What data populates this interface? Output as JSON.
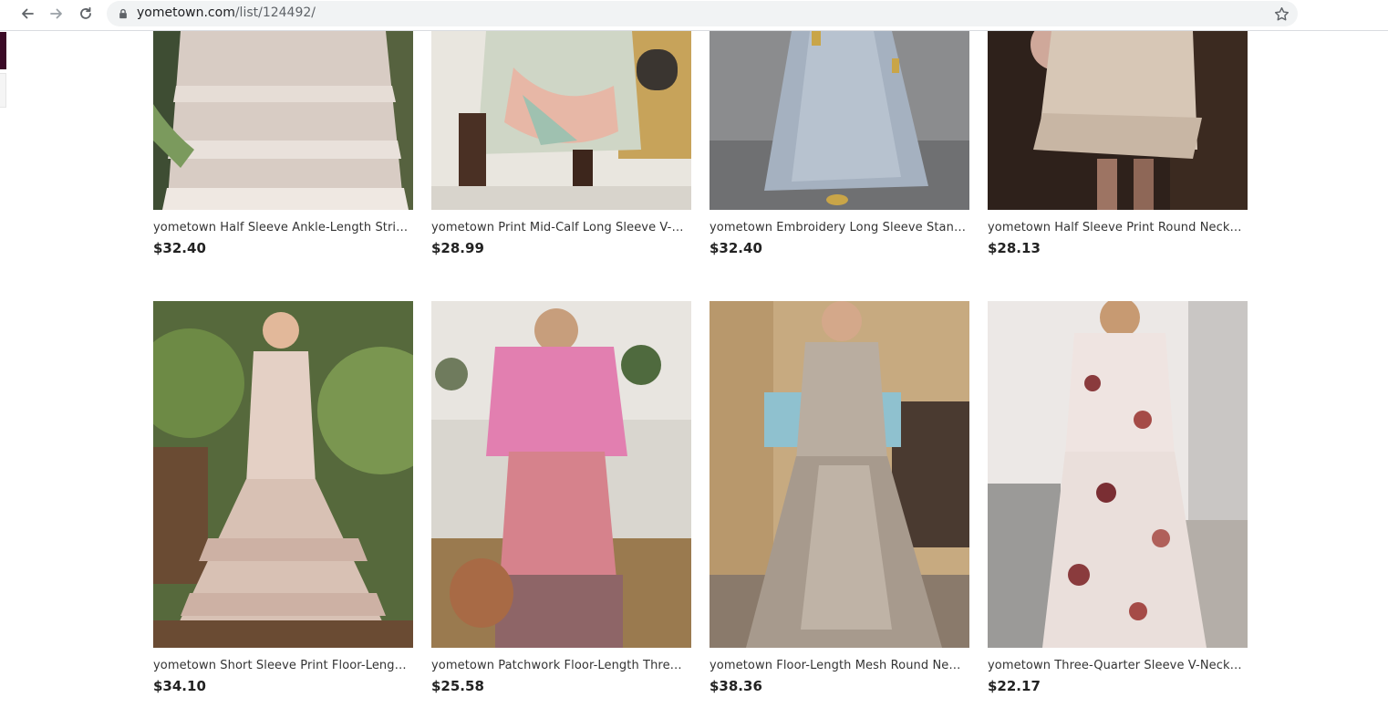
{
  "browser": {
    "url_host": "yometown.com",
    "url_path": "/list/124492/",
    "icons": [
      "back-arrow-icon",
      "forward-arrow-icon",
      "reload-icon",
      "lock-icon",
      "bookmark-star-icon"
    ]
  },
  "products": [
    {
      "title": "yometown Half Sleeve Ankle-Length Stringy Selvedge Pullover Dress",
      "price": "$32.40"
    },
    {
      "title": "yometown Print Mid-Calf Long Sleeve V-Neck Pullover Dress",
      "price": "$28.99"
    },
    {
      "title": "yometown Embroidery Long Sleeve Stand Collar Maxi Dress",
      "price": "$32.40"
    },
    {
      "title": "yometown Half Sleeve Print Round Neck Mid-Calf Dress",
      "price": "$28.13"
    },
    {
      "title": "yometown Short Sleeve Print Floor-Length Ruffle Dress",
      "price": "$34.10"
    },
    {
      "title": "yometown Patchwork Floor-Length Three-Quarter Sleeve Dress",
      "price": "$25.58"
    },
    {
      "title": "yometown Floor-Length Mesh Round Neck Three-Quarter Sleeve Dress",
      "price": "$38.36"
    },
    {
      "title": "yometown Three-Quarter Sleeve V-Neck Ankle-Length Dress",
      "price": "$22.17"
    }
  ],
  "colors": {
    "omnibox_bg": "#f1f3f4",
    "left_accent": "#3b0a26",
    "price_text": "#222222",
    "title_text": "#333333"
  }
}
